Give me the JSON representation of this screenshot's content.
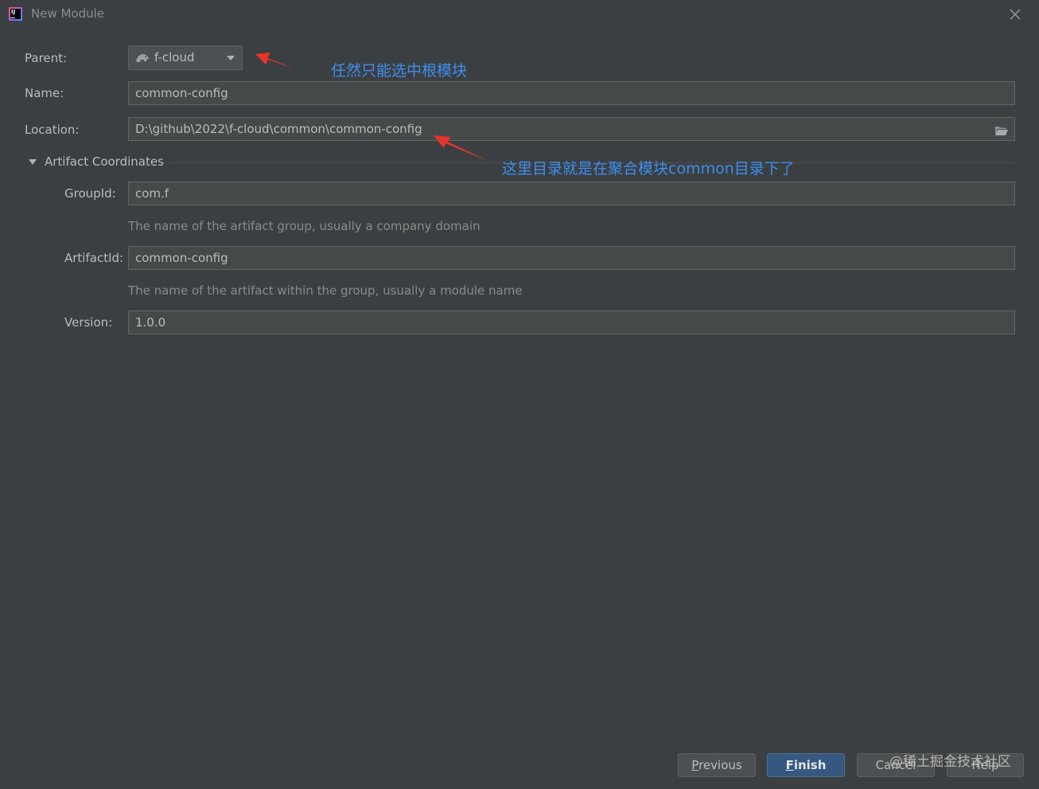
{
  "window": {
    "title": "New Module"
  },
  "parent": {
    "label": "Parent:",
    "value": "f-cloud"
  },
  "name": {
    "label": "Name:",
    "value": "common-config"
  },
  "location": {
    "label": "Location:",
    "value": "D:\\github\\2022\\f-cloud\\common\\common-config"
  },
  "artifact": {
    "section_title": "Artifact Coordinates",
    "groupid_label": "GroupId:",
    "groupid_value": "com.f",
    "groupid_hint": "The name of the artifact group, usually a company domain",
    "artifactid_label": "ArtifactId:",
    "artifactid_value": "common-config",
    "artifactid_hint": "The name of the artifact within the group, usually a module name",
    "version_label": "Version:",
    "version_value": "1.0.0"
  },
  "annotations": {
    "parent_note": "任然只能选中根模块",
    "location_note": "这里目录就是在聚合模块common目录下了"
  },
  "buttons": {
    "previous_mnemonic": "P",
    "previous_rest": "revious",
    "finish_mnemonic": "F",
    "finish_rest": "inish",
    "cancel": "Cancel",
    "help": "Help"
  },
  "watermark": "@稀土掘金技术社区",
  "colors": {
    "background": "#3c3f41",
    "field": "#45494a",
    "annotation": "#3d8ef0",
    "arrow": "#e8352b",
    "primary_button": "#365880"
  },
  "icons": [
    "intellij-app-icon",
    "close-icon",
    "module-icon",
    "dropdown-arrow-icon",
    "folder-open-icon",
    "collapse-triangle-icon"
  ]
}
